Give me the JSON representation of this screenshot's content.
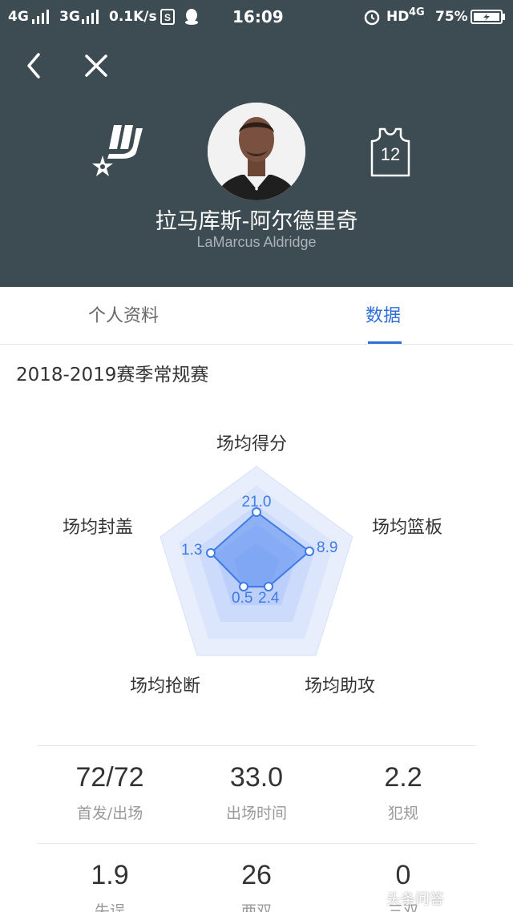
{
  "status_bar": {
    "network1": "4G",
    "network2": "3G",
    "speed": "0.1K/s",
    "time": "16:09",
    "hd": "HD",
    "network3": "4G",
    "battery": "75%"
  },
  "player": {
    "name_cn": "拉马库斯-阿尔德里奇",
    "name_en": "LaMarcus Aldridge",
    "jersey_number": "12",
    "team_logo_icon": "spurs-logo-icon",
    "avatar_icon": "player-photo"
  },
  "tabs": [
    {
      "label": "个人资料",
      "active": false
    },
    {
      "label": "数据",
      "active": true
    }
  ],
  "season": "2018-2019赛季常规赛",
  "radar": {
    "labels": [
      "场均得分",
      "场均篮板",
      "场均助攻",
      "场均抢断",
      "场均封盖"
    ],
    "values": [
      "21.0",
      "8.9",
      "2.4",
      "0.5",
      "1.3"
    ]
  },
  "stats": [
    [
      {
        "value": "72/72",
        "label": "首发/出场"
      },
      {
        "value": "33.0",
        "label": "出场时间"
      },
      {
        "value": "2.2",
        "label": "犯规"
      }
    ],
    [
      {
        "value": "1.9",
        "label": "失误"
      },
      {
        "value": "26",
        "label": "两双"
      },
      {
        "value": "0",
        "label": "三双"
      }
    ]
  ],
  "watermark": "头条问答",
  "colors": {
    "header_bg": "#3d4b53",
    "accent": "#2e6fd8",
    "radar_fill": "#5b8ff0"
  }
}
